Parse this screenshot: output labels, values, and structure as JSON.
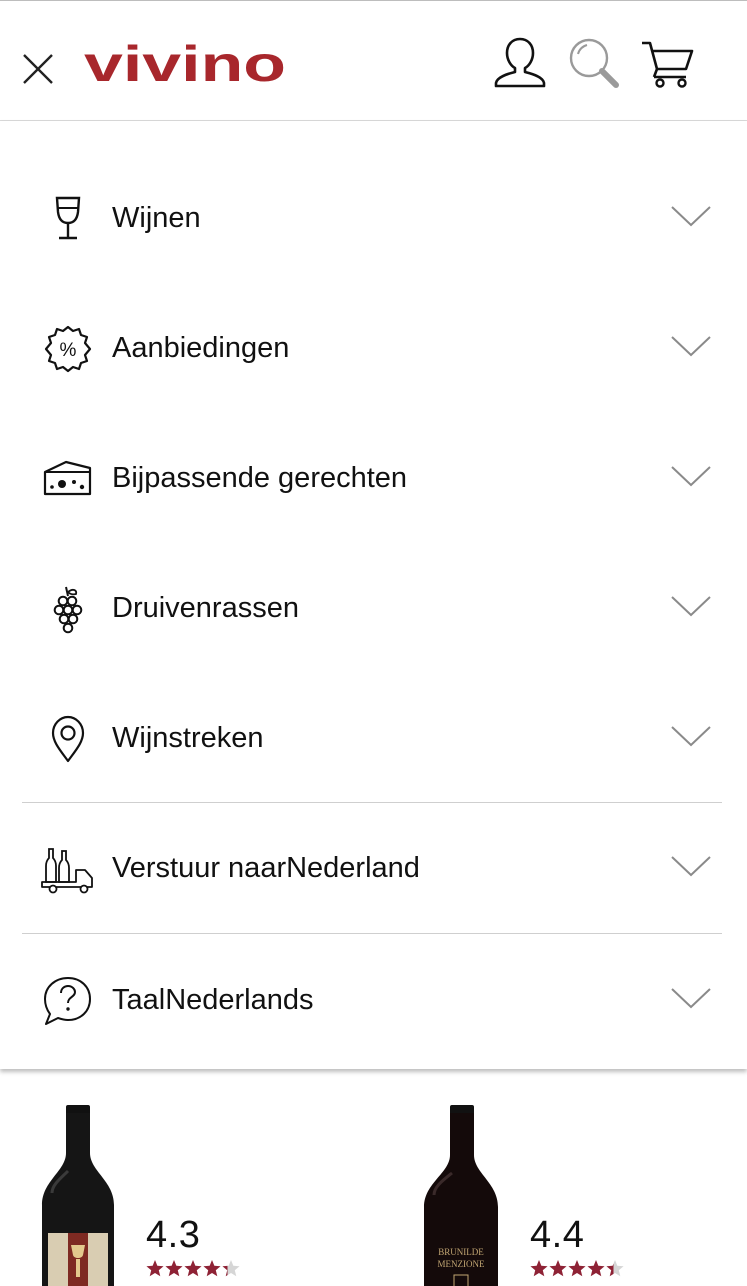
{
  "header": {
    "logo_text": "vivino",
    "brand_color": "#a8272c",
    "icons": [
      "close-icon",
      "user-icon",
      "search-icon",
      "cart-icon"
    ]
  },
  "menu": {
    "items": [
      {
        "label": "Wijnen",
        "icon": "wine-glass-icon"
      },
      {
        "label": "Aanbiedingen",
        "icon": "discount-badge-icon"
      },
      {
        "label": "Bijpassende gerechten",
        "icon": "cheese-icon"
      },
      {
        "label": "Druivenrassen",
        "icon": "grapes-icon"
      },
      {
        "label": "Wijnstreken",
        "icon": "location-pin-icon"
      },
      {
        "label": "Verstuur naarNederland",
        "icon": "shipping-truck-icon"
      },
      {
        "label": "TaalNederlands",
        "icon": "help-bubble-icon"
      }
    ]
  },
  "wines": [
    {
      "rating": "4.3",
      "stars": 4.3,
      "label_text": ""
    },
    {
      "rating": "4.4",
      "stars": 4.4,
      "label_text": "BRUNILDE MENZIONE"
    }
  ],
  "colors": {
    "star": "#8e2235",
    "star_empty": "#d6d6d6",
    "divider": "#cfcfcf"
  }
}
